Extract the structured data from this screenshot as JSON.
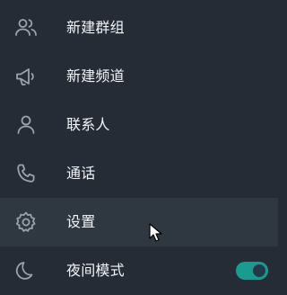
{
  "menu": {
    "items": [
      {
        "label": "新建群组",
        "icon": "people-icon"
      },
      {
        "label": "新建频道",
        "icon": "megaphone-icon"
      },
      {
        "label": "联系人",
        "icon": "person-icon"
      },
      {
        "label": "通话",
        "icon": "phone-icon"
      },
      {
        "label": "设置",
        "icon": "gear-icon"
      },
      {
        "label": "夜间模式",
        "icon": "moon-icon"
      }
    ],
    "hovered_item": "设置",
    "night_mode_enabled": true
  },
  "colors": {
    "background": "#262c36",
    "hover_background": "#2f3741",
    "icon": "#9aa3ad",
    "text": "#f2f4f7",
    "toggle_on": "#1b9b8f"
  }
}
